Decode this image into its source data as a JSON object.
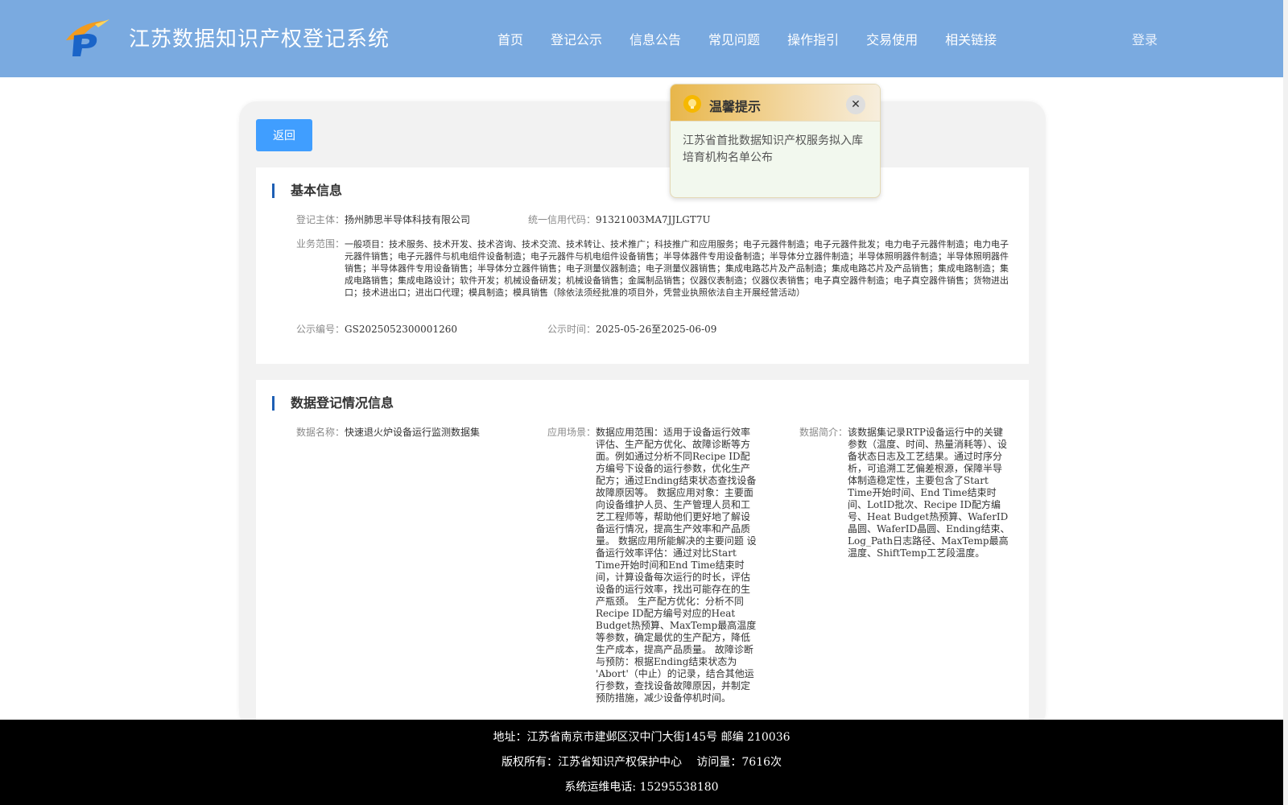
{
  "header": {
    "site_title": "江苏数据知识产权登记系统",
    "nav": [
      "首页",
      "登记公示",
      "信息公告",
      "常见问题",
      "操作指引",
      "交易使用",
      "相关链接"
    ],
    "login": "登录"
  },
  "back_label": "返回",
  "basic": {
    "title": "基本信息",
    "subject_label": "登记主体：",
    "subject_value": "扬州肺思半导体科技有限公司",
    "credit_label": "统一信用代码：",
    "credit_value": "91321003MA7JJLGT7U",
    "scope_label": "业务范围：",
    "scope_value": "一般项目：技术服务、技术开发、技术咨询、技术交流、技术转让、技术推广；科技推广和应用服务；电子元器件制造；电子元器件批发；电力电子元器件制造；电力电子元器件销售；电子元器件与机电组件设备制造；电子元器件与机电组件设备销售；半导体器件专用设备制造；半导体分立器件制造；半导体照明器件制造；半导体照明器件销售；半导体器件专用设备销售；半导体分立器件销售；电子测量仪器制造；电子测量仪器销售；集成电路芯片及产品制造；集成电路芯片及产品销售；集成电路制造；集成电路销售；集成电路设计；软件开发；机械设备研发；机械设备销售；金属制品销售；仪器仪表制造；仪器仪表销售；电子真空器件制造；电子真空器件销售；货物进出口；技术进出口；进出口代理；模具制造；模具销售（除依法须经批准的项目外，凭营业执照依法自主开展经营活动）",
    "pub_no_label": "公示编号：",
    "pub_no_value": "GS2025052300001260",
    "pub_time_label": "公示时间：",
    "pub_time_value": "2025-05-26至2025-06-09"
  },
  "registration": {
    "title": "数据登记情况信息",
    "name_label": "数据名称：",
    "name_value": "快速退火炉设备运行监测数据集",
    "scene_label": "应用场景：",
    "scene_value": "数据应用范围：适用于设备运行效率评估、生产配方优化、故障诊断等方面。例如通过分析不同Recipe ID配方编号下设备的运行参数，优化生产配方；通过Ending结束状态查找设备故障原因等。 数据应用对象：主要面向设备维护人员、生产管理人员和工艺工程师等，帮助他们更好地了解设备运行情况，提高生产效率和产品质量。 数据应用所能解决的主要问题 设备运行效率评估：通过对比Start Time开始时间和End Time结束时间，计算设备每次运行的时长，评估设备的运行效率，找出可能存在的生产瓶颈。 生产配方优化：分析不同Recipe ID配方编号对应的Heat Budget热预算、MaxTemp最高温度等参数，确定最优的生产配方，降低生产成本，提高产品质量。 故障诊断与预防：根据Ending结束状态为 'Abort'（中止）的记录，结合其他运行参数，查找设备故障原因，并制定预防措施，减少设备停机时间。",
    "intro_label": "数据简介：",
    "intro_value": "该数据集记录RTP设备运行中的关键参数（温度、时间、热量消耗等）、设备状态日志及工艺结果。通过时序分析，可追溯工艺偏差根源，保障半导体制造稳定性，主要包含了Start Time开始时间、End Time结束时间、LotID批次、Recipe ID配方编号、Heat Budget热预算、WaferID晶圆、WaferID晶圆、Ending结束、Log_Path日志路径、MaxTemp最高温度、ShiftTemp工艺段温度。"
  },
  "popup": {
    "title": "温馨提示",
    "body": "江苏省首批数据知识产权服务拟入库培育机构名单公布"
  },
  "footer": {
    "address": "地址：江苏省南京市建邺区汉中门大街145号 邮编 210036",
    "copyright": "版权所有：江苏省知识产权保护中心　  访问量：7616次",
    "phone": "系统运维电话: 15295538180"
  }
}
